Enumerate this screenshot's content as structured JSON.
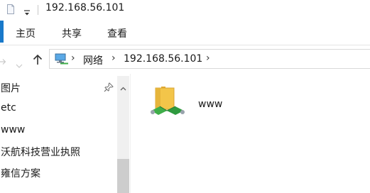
{
  "window": {
    "title": "192.168.56.101"
  },
  "ribbon": {
    "tabs": [
      {
        "label": "主页"
      },
      {
        "label": "共享"
      },
      {
        "label": "查看"
      }
    ]
  },
  "address": {
    "crumbs": [
      {
        "label": "网络"
      },
      {
        "label": "192.168.56.101"
      }
    ]
  },
  "nav": {
    "items": [
      {
        "label": "图片",
        "pinned": true
      },
      {
        "label": "etc"
      },
      {
        "label": "www"
      },
      {
        "label": "沃航科技营业执照"
      },
      {
        "label": "雍信方案"
      }
    ]
  },
  "content": {
    "items": [
      {
        "label": "www",
        "icon": "shared-folder-icon"
      }
    ]
  },
  "colors": {
    "accent": "#1979ca",
    "folder": "#f3c549",
    "share": "#3fae49"
  }
}
